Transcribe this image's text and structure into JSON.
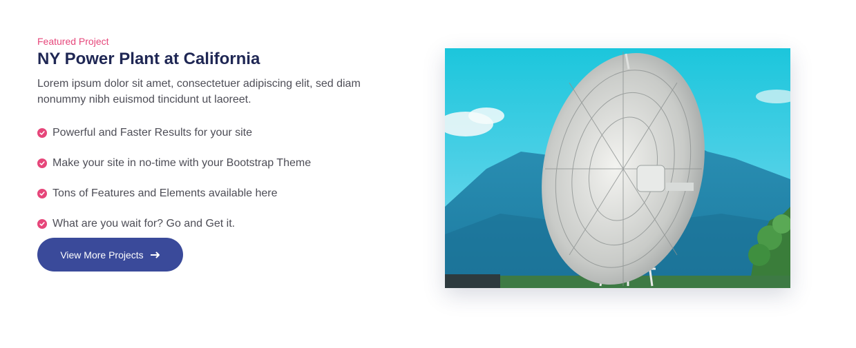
{
  "featured": {
    "eyebrow": "Featured Project",
    "title": "NY Power Plant at California",
    "description": "Lorem ipsum dolor sit amet, consectetuer adipiscing elit, sed diam nonummy nibh euismod tincidunt ut laoreet.",
    "features": [
      "Powerful and Faster Results for your site",
      "Make your site in no-time with your Bootstrap Theme",
      "Tons of Features and Elements available here",
      "What are you wait for? Go and Get it."
    ],
    "button_label": "View More Projects"
  },
  "icons": {
    "feature_bullet": "check-circle-icon",
    "button_arrow": "arrow-right-icon"
  },
  "colors": {
    "accent": "#e6467a",
    "heading": "#1f2754",
    "button": "#3a4a9a",
    "body_text": "#4d4d56"
  }
}
